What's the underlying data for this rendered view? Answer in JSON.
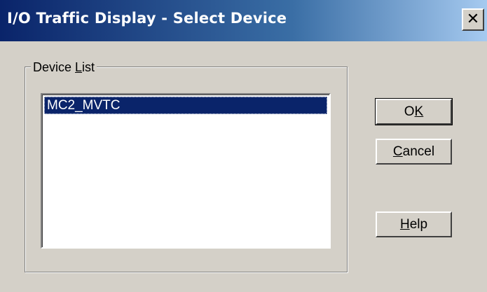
{
  "window": {
    "title": "I/O Traffic Display - Select Device",
    "close_glyph": "✕"
  },
  "device_list": {
    "group_label_prefix": "Device ",
    "group_label_mnemonic": "L",
    "group_label_suffix": "ist",
    "items": [
      {
        "label": "MC2_MVTC",
        "selected": true
      }
    ]
  },
  "buttons": {
    "ok": {
      "prefix": "O",
      "mnemonic": "K",
      "suffix": ""
    },
    "cancel": {
      "prefix": "",
      "mnemonic": "C",
      "suffix": "ancel"
    },
    "help": {
      "prefix": "",
      "mnemonic": "H",
      "suffix": "elp"
    }
  },
  "colors": {
    "title_start": "#0a246a",
    "title_end": "#a6caf0",
    "selection": "#0a246a",
    "face": "#d4d0c8"
  }
}
